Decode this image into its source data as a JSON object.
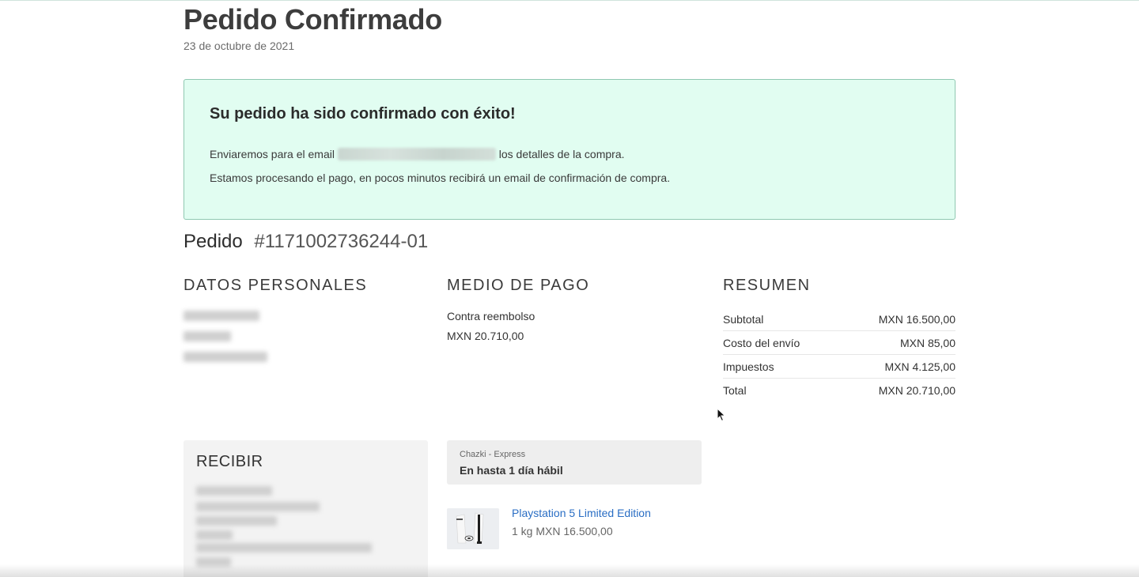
{
  "header": {
    "title": "Pedido Confirmado",
    "date": "23 de octubre de 2021"
  },
  "confirmation": {
    "title": "Su pedido ha sido confirmado con éxito!",
    "email_prefix": "Enviaremos para el email",
    "email_suffix": "los detalles de la compra.",
    "processing_text": "Estamos procesando el pago, en pocos minutos recibirá un email de confirmación de compra."
  },
  "order": {
    "label": "Pedido",
    "number": "#1171002736244-01"
  },
  "sections": {
    "personal": "DATOS PERSONALES",
    "payment": "MEDIO DE PAGO",
    "summary": "RESUMEN"
  },
  "payment": {
    "method": "Contra reembolso",
    "amount": "MXN 20.710,00"
  },
  "summary": {
    "rows": [
      {
        "label": "Subtotal",
        "value": "MXN 16.500,00"
      },
      {
        "label": "Costo del envío",
        "value": "MXN 85,00"
      },
      {
        "label": "Impuestos",
        "value": "MXN 4.125,00"
      },
      {
        "label": "Total",
        "value": "MXN 20.710,00"
      }
    ]
  },
  "receive": {
    "title": "RECIBIR"
  },
  "shipping": {
    "carrier": "Chazki - Express",
    "estimate": "En hasta 1 día hábil"
  },
  "product": {
    "name": "Playstation 5 Limited Edition",
    "meta": "1 kg MXN 16.500,00"
  },
  "colors": {
    "success_bg": "#e1fdf1",
    "success_border": "#8fc8b1",
    "link": "#2a6ec4"
  }
}
